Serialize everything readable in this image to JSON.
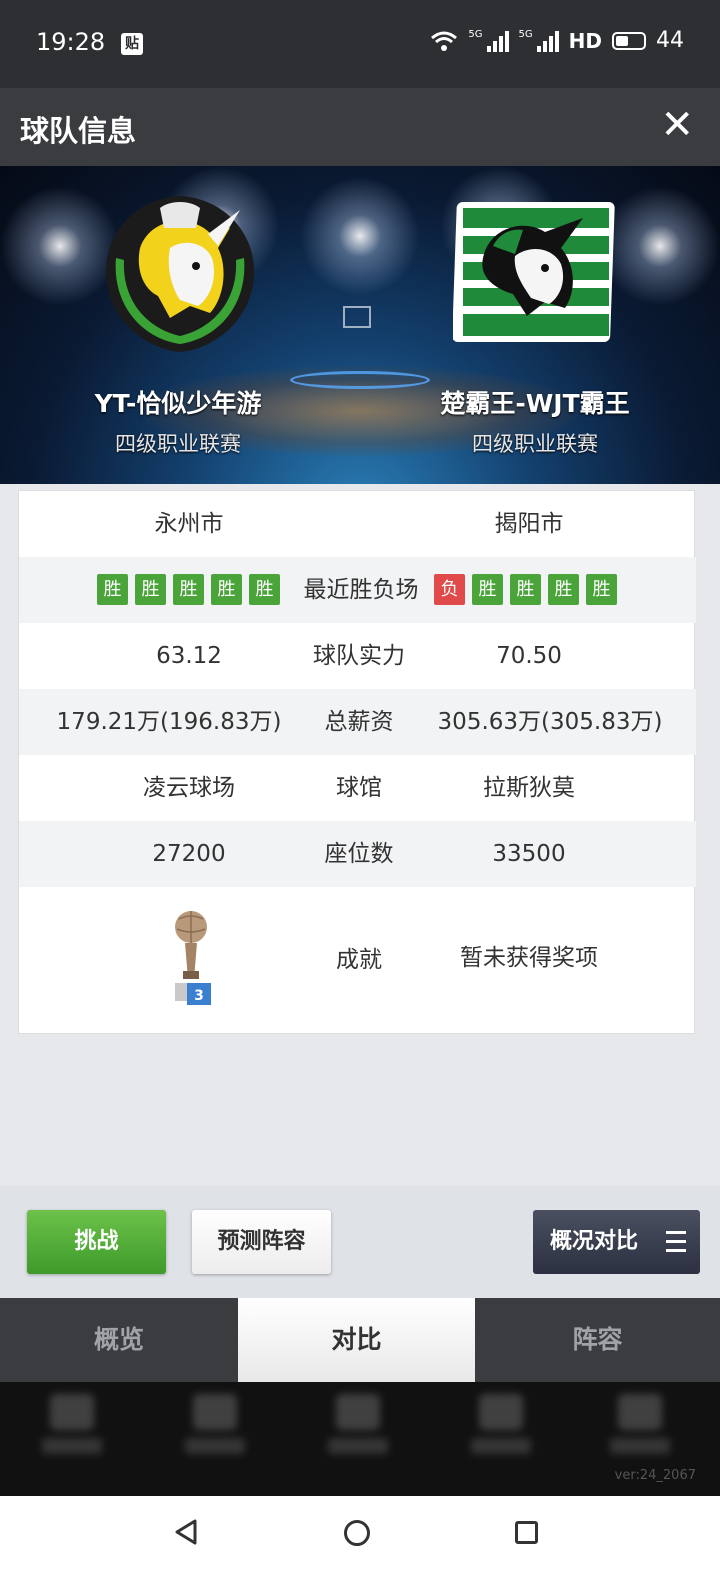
{
  "status_bar": {
    "time": "19:28",
    "notification": "贴",
    "signal1_label": "5G",
    "signal2_label": "5G",
    "hd_label": "HD",
    "battery": "44"
  },
  "header": {
    "title": "球队信息",
    "close_icon": "close-icon",
    "close_label": "✕"
  },
  "teams": {
    "left": {
      "name": "YT-恰似少年游",
      "league": "四级职业联赛",
      "logo": "unicorn-yellow-crest",
      "logo_colors": [
        "#f2d21b",
        "#3aa335",
        "#111111"
      ]
    },
    "right": {
      "name": "楚霸王-WJT霸王",
      "league": "四级职业联赛",
      "logo": "unicorn-green-stripes",
      "logo_colors": [
        "#1e8a3a",
        "#ffffff",
        "#111111"
      ]
    }
  },
  "comparison": {
    "city": {
      "left": "永州市",
      "right": "揭阳市"
    },
    "recent": {
      "label": "最近胜负场",
      "left": [
        "胜",
        "胜",
        "胜",
        "胜",
        "胜"
      ],
      "right": [
        "负",
        "胜",
        "胜",
        "胜",
        "胜"
      ],
      "win_color": "#4aa43a",
      "loss_color": "#e04a4a"
    },
    "strength": {
      "label": "球队实力",
      "left": "63.12",
      "right": "70.50"
    },
    "salary": {
      "label": "总薪资",
      "left": "179.21万(196.83万)",
      "right": "305.63万(305.83万)"
    },
    "arena": {
      "label": "球馆",
      "left": "凌云球场",
      "right": "拉斯狄莫"
    },
    "seats": {
      "label": "座位数",
      "left": "27200",
      "right": "33500"
    },
    "achievement": {
      "label": "成就",
      "left_trophy_count": "3",
      "right": "暂未获得奖项"
    }
  },
  "actions": {
    "challenge": "挑战",
    "predict": "预测阵容",
    "compare": "概况对比"
  },
  "tabs": [
    {
      "label": "概览",
      "active": false
    },
    {
      "label": "对比",
      "active": true
    },
    {
      "label": "阵容",
      "active": false
    }
  ],
  "footer": {
    "version": "ver:24_2067"
  },
  "colors": {
    "accent_green": "#4aa43a",
    "header_bg": "#3a3c40",
    "status_bg": "#2d2f32"
  }
}
